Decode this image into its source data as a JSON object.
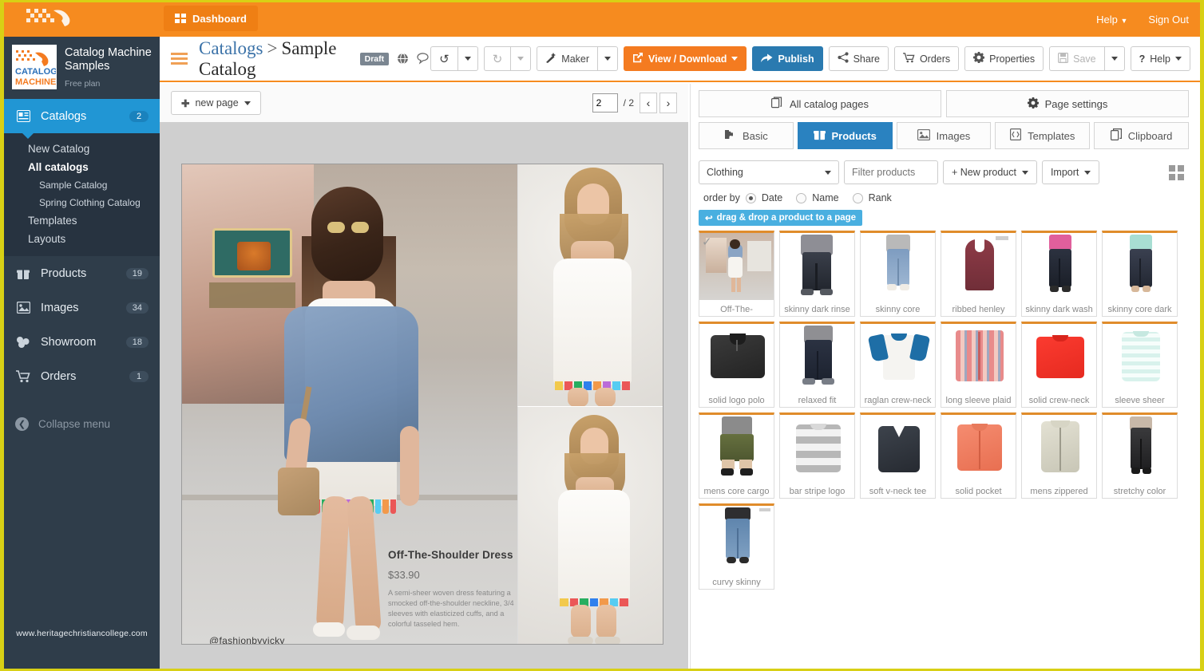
{
  "topbar": {
    "dashboard_label": "Dashboard",
    "dashboard_icon": "grid-icon",
    "help_label": "Help",
    "signout_label": "Sign Out",
    "bg_color": "#f68b1f"
  },
  "sidebar": {
    "brand_name": "Catalog Machine Samples",
    "brand_plan": "Free plan",
    "logo_text_1": "CATALOG",
    "logo_text_2": "MACHINE",
    "items": [
      {
        "label": "Catalogs",
        "badge": "2",
        "icon": "catalog-icon",
        "active": true
      },
      {
        "label": "Products",
        "badge": "19",
        "icon": "gift-icon",
        "active": false
      },
      {
        "label": "Images",
        "badge": "34",
        "icon": "image-icon",
        "active": false
      },
      {
        "label": "Showroom",
        "badge": "18",
        "icon": "showroom-icon",
        "active": false
      },
      {
        "label": "Orders",
        "badge": "1",
        "icon": "cart-icon",
        "active": false
      }
    ],
    "submenu": [
      {
        "label": "New Catalog",
        "level": "1",
        "bold": false
      },
      {
        "label": "All catalogs",
        "level": "1",
        "bold": true
      },
      {
        "label": "Sample Catalog",
        "level": "2",
        "bold": false
      },
      {
        "label": "Spring Clothing Catalog",
        "level": "2",
        "bold": false
      },
      {
        "label": "Templates",
        "level": "1",
        "bold": false
      },
      {
        "label": "Layouts",
        "level": "1",
        "bold": false
      }
    ],
    "collapse_label": "Collapse menu",
    "watermark": "www.heritagechristiancollege.com"
  },
  "header": {
    "breadcrumb_root": "Catalogs",
    "breadcrumb_sep": ">",
    "breadcrumb_current": "Sample Catalog",
    "status_badge": "Draft",
    "globe_icon": "globe-icon",
    "comment_icon": "comment-icon",
    "menu_icon": "hamburger-icon",
    "buttons": {
      "undo": "↺",
      "redo": "↻",
      "maker": "Maker",
      "view_download": "View / Download",
      "publish": "Publish",
      "share": "Share",
      "orders": "Orders",
      "properties": "Properties",
      "save": "Save",
      "help": "Help"
    }
  },
  "canvas": {
    "new_page_label": "new page",
    "page_number": "2",
    "page_total": "/ 2",
    "prev_icon": "chevron-left-icon",
    "next_icon": "chevron-right-icon",
    "page_content": {
      "product_title": "Off-The-Shoulder Dress",
      "product_price": "$33.90",
      "product_desc": "A semi-sheer woven dress featuring a smocked off-the-shoulder neckline, 3/4 sleeves with elasticized cuffs, and a colorful tasseled hem.",
      "handle": "@fashionbyvicky"
    }
  },
  "rightpanel": {
    "top_tabs": [
      {
        "label": "All catalog pages",
        "icon": "pages-icon"
      },
      {
        "label": "Page settings",
        "icon": "gear-icon"
      }
    ],
    "sub_tabs": [
      {
        "label": "Basic",
        "icon": "puzzle-icon",
        "active": false
      },
      {
        "label": "Products",
        "icon": "gift-icon",
        "active": true
      },
      {
        "label": "Images",
        "icon": "image-icon",
        "active": false
      },
      {
        "label": "Templates",
        "icon": "template-icon",
        "active": false
      },
      {
        "label": "Clipboard",
        "icon": "clipboard-icon",
        "active": false
      }
    ],
    "category_select": "Clothing",
    "filter_placeholder": "Filter products",
    "new_product_label": "+ New product",
    "import_label": "Import",
    "grid_toggle_icon": "grid-view-icon",
    "order_by_label": "order by",
    "order_options": [
      {
        "label": "Date",
        "selected": true
      },
      {
        "label": "Name",
        "selected": false
      },
      {
        "label": "Rank",
        "selected": false
      }
    ],
    "drag_hint": "drag & drop a product to a page",
    "products": [
      {
        "name": "Off-The-",
        "kind": "street-dress",
        "checked": true
      },
      {
        "name": "skinny dark rinse",
        "kind": "dark-jeans-man",
        "checked": false
      },
      {
        "name": "skinny core",
        "kind": "light-jeans",
        "checked": false
      },
      {
        "name": "ribbed henley",
        "kind": "maroon-tank",
        "checked": false
      },
      {
        "name": "skinny dark wash",
        "kind": "dark-jeans-pink",
        "checked": false
      },
      {
        "name": "skinny core dark",
        "kind": "dark-jeans-mint",
        "checked": false
      },
      {
        "name": "solid logo polo",
        "kind": "black-polo",
        "checked": false
      },
      {
        "name": "relaxed fit",
        "kind": "navy-pants",
        "checked": false
      },
      {
        "name": "raglan crew-neck",
        "kind": "raglan-tee",
        "checked": false
      },
      {
        "name": "long sleeve plaid",
        "kind": "plaid-shirt",
        "checked": false
      },
      {
        "name": "solid crew-neck",
        "kind": "red-tee",
        "checked": false
      },
      {
        "name": "sleeve sheer",
        "kind": "mint-stripe-top",
        "checked": false
      },
      {
        "name": "mens core cargo",
        "kind": "cargo-shorts",
        "checked": false
      },
      {
        "name": "bar stripe logo",
        "kind": "gray-stripe-tee",
        "checked": false
      },
      {
        "name": "soft v-neck tee",
        "kind": "charcoal-vneck",
        "checked": false
      },
      {
        "name": "solid pocket",
        "kind": "coral-shirt",
        "checked": false
      },
      {
        "name": "mens zippered",
        "kind": "beige-jacket",
        "checked": false
      },
      {
        "name": "stretchy color",
        "kind": "black-legging",
        "checked": false
      },
      {
        "name": "curvy skinny",
        "kind": "blue-jeans-woman",
        "checked": false
      }
    ]
  },
  "colors": {
    "orange": "#f68b1f",
    "blue": "#2a82c0",
    "sidebar": "#2f3d4a",
    "page_border": "#d8d015",
    "card_top": "#e08c2b"
  }
}
